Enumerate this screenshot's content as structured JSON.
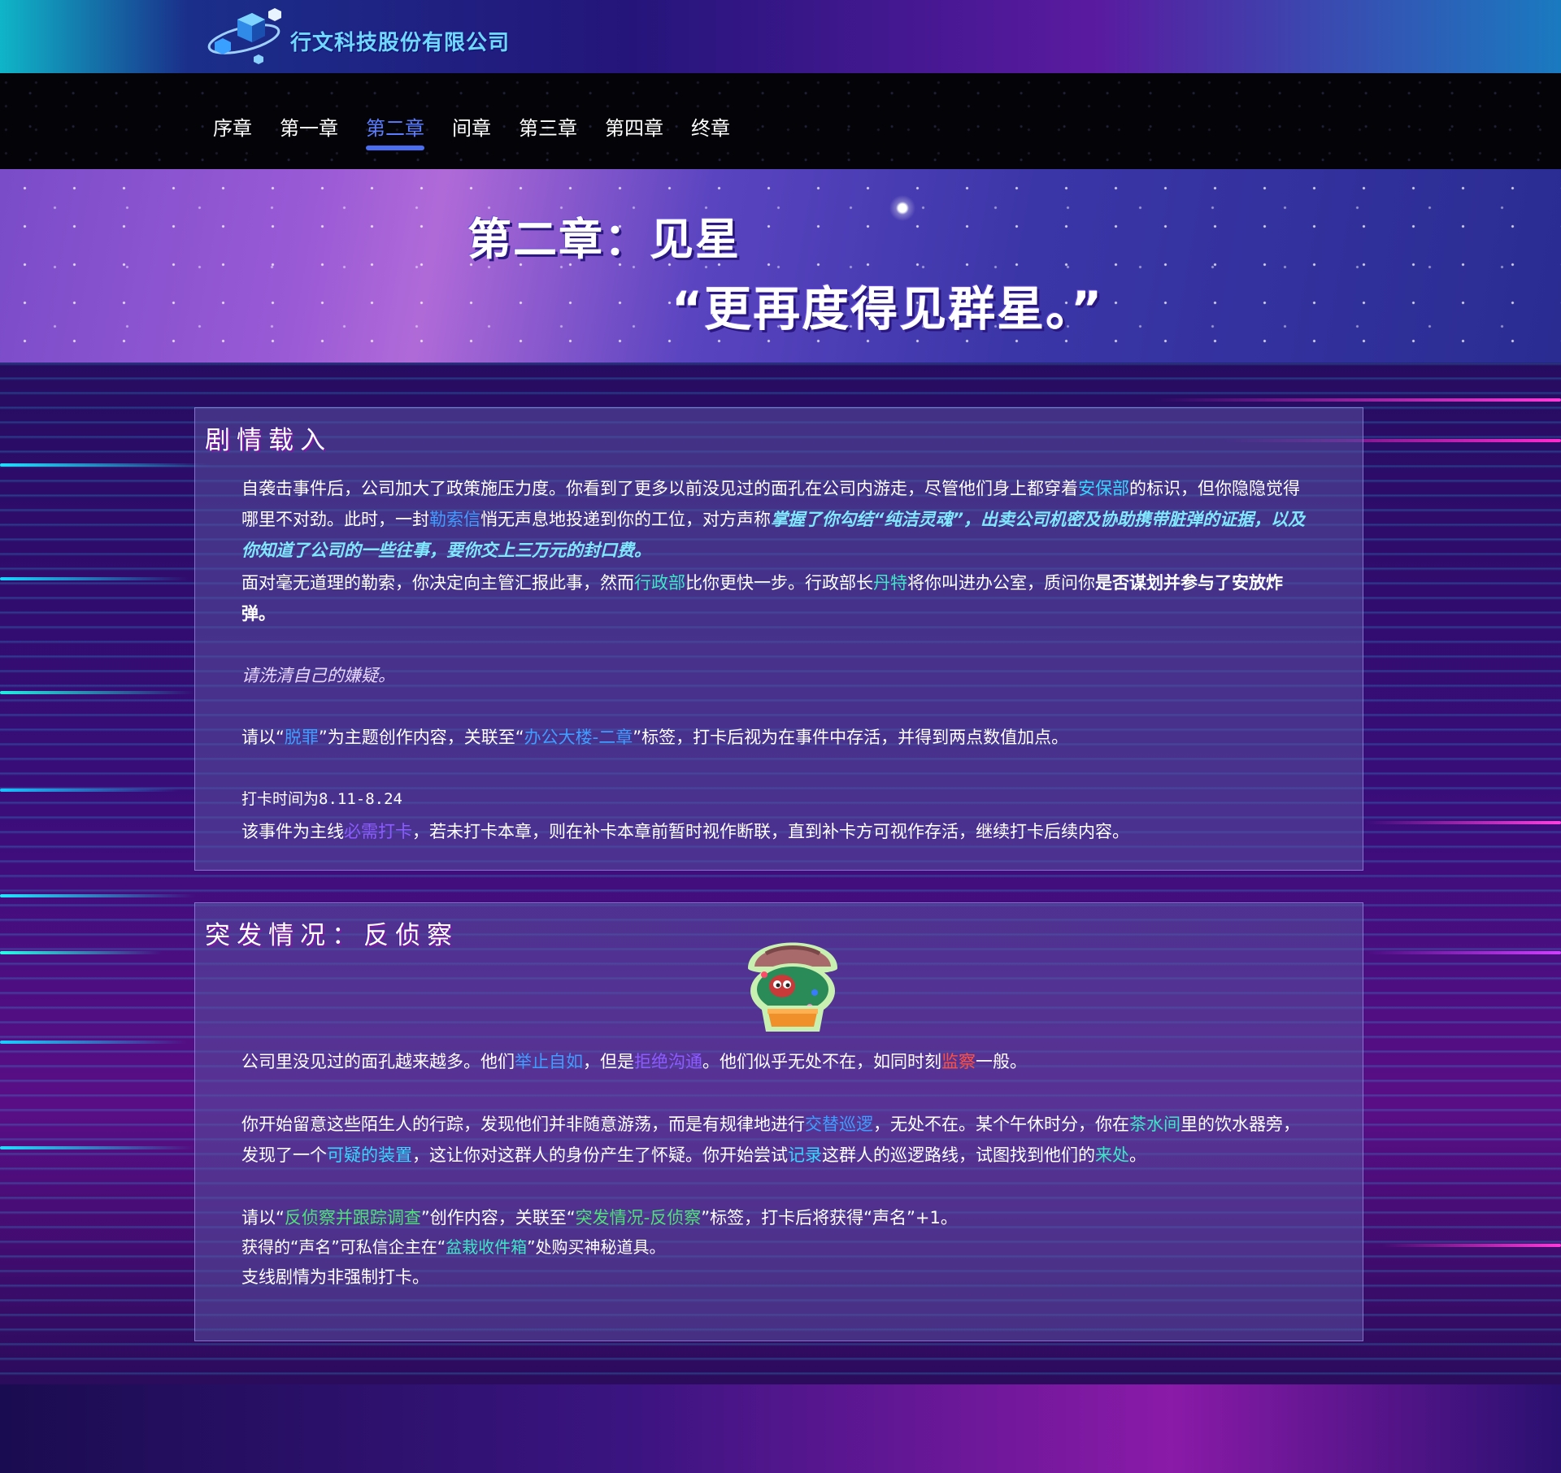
{
  "header": {
    "brand": "行文科技股份有限公司",
    "logo_icon": "cube-cluster-logo"
  },
  "nav": {
    "items": [
      "序章",
      "第一章",
      "第二章",
      "间章",
      "第三章",
      "第四章",
      "终章"
    ],
    "active_index": 2
  },
  "hero": {
    "title": "第二章：见星",
    "quote": "“更再度得见群星。”"
  },
  "panel1": {
    "title": "剧情载入",
    "p1": {
      "t1": "自袭击事件后，公司加大了政策施压力度。你看到了更多以前没见过的面孔在公司内游走，尽管他们身上都穿着",
      "k1": "安保部",
      "t2": "的标识，但你隐隐觉得哪里不对劲。此时，一封",
      "k2": "勒索信",
      "t3": "悄无声息地投递到你的工位，对方声称",
      "k3": "掌握了你勾结“纯洁灵魂”，出卖公司机密及协助携带脏弹的证据，以及你知道了公司的一些往事，要你交上三万元的封口费。"
    },
    "p2": {
      "t1": "面对毫无道理的勒索，你决定向主管汇报此事，然而",
      "k1": "行政部",
      "t2": "比你更快一步。行政部长",
      "k2": "丹特",
      "t3": "将你叫进办公室，质问你",
      "k3": "是否谋划并参与了安放炸弹。"
    },
    "p3": "请洗清自己的嫌疑。",
    "p4": {
      "t1": "请以“",
      "k1": "脱罪",
      "t2": "”为主题创作内容，关联至“",
      "k2": "办公大楼-二章",
      "t3": "”标签，打卡后视为在事件中存活，并得到两点数值加点。"
    },
    "p5": "打卡时间为8.11-8.24",
    "p6": {
      "t1": "该事件为主线",
      "k1": "必需打卡",
      "t2": "，若未打卡本章，则在补卡本章前暂时视作断联，直到补卡方可视作存活，继续打卡后续内容。"
    }
  },
  "panel2": {
    "title": "突发情况：反侦察",
    "mascot_icon": "potted-plant-mushroom-mascot",
    "p1": {
      "t1": "公司里没见过的面孔越来越多。他们",
      "k1": "举止自如",
      "t2": "，但是",
      "k2": "拒绝沟通",
      "t3": "。他们似乎无处不在，如同时刻",
      "k3": "监察",
      "t4": "一般。"
    },
    "p2": {
      "t1": "你开始留意这些陌生人的行踪，发现他们并非随意游荡，而是有规律地进行",
      "k1": "交替巡逻",
      "t2": "，无处不在。某个午休时分，你在",
      "k2": "茶水间",
      "t3": "里的饮水器旁，发现了一个",
      "k3": "可疑的装置",
      "t4": "，这让你对这群人的身份产生了怀疑。你开始尝试",
      "k4": "记录",
      "t5": "这群人的巡逻路线，试图找到他们的",
      "k5": "来处",
      "t6": "。"
    },
    "p3": {
      "t1": "请以“",
      "k1": "反侦察并跟踪调查",
      "t2": "”创作内容，关联至“",
      "k2": "突发情况-反侦察",
      "t3": "”标签，打卡后将获得“声名”+1。"
    },
    "p4": {
      "t1": "获得的“声名”可私信企主在“",
      "k1": "盆栽收件箱",
      "t2": "”处购买神秘道具。"
    },
    "p5": "支线剧情为非强制打卡。"
  },
  "colors": {
    "accent_blue": "#4b6df0",
    "keyword_cyan": "#38d6ff",
    "keyword_green": "#4fe07a",
    "keyword_red": "#ff5040",
    "keyword_violet": "#8b5cff"
  }
}
